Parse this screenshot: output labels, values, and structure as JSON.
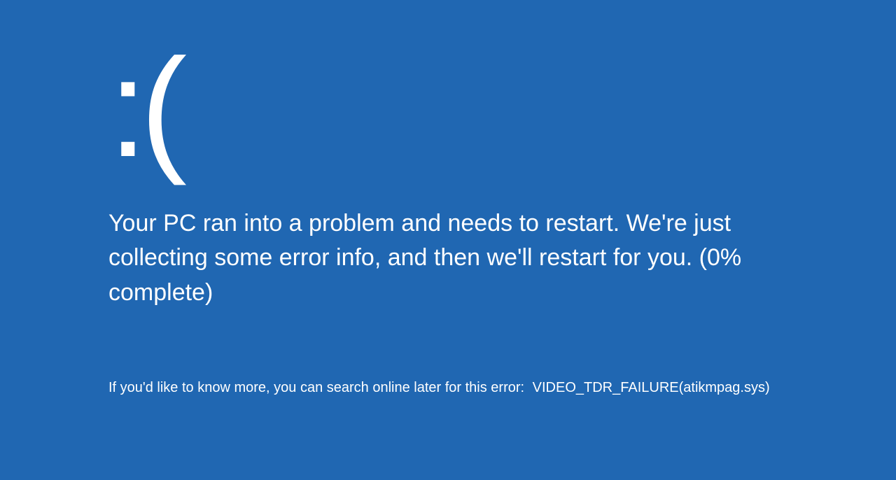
{
  "bsod": {
    "emoticon": ":(",
    "message": "Your PC ran into a problem and needs to restart. We're just collecting some error info, and then we'll restart for you. (0% complete)",
    "footer_prefix": "If you'd like to know more, you can search online later for this error:",
    "error_code": "VIDEO_TDR_FAILURE(atikmpag.sys)"
  }
}
